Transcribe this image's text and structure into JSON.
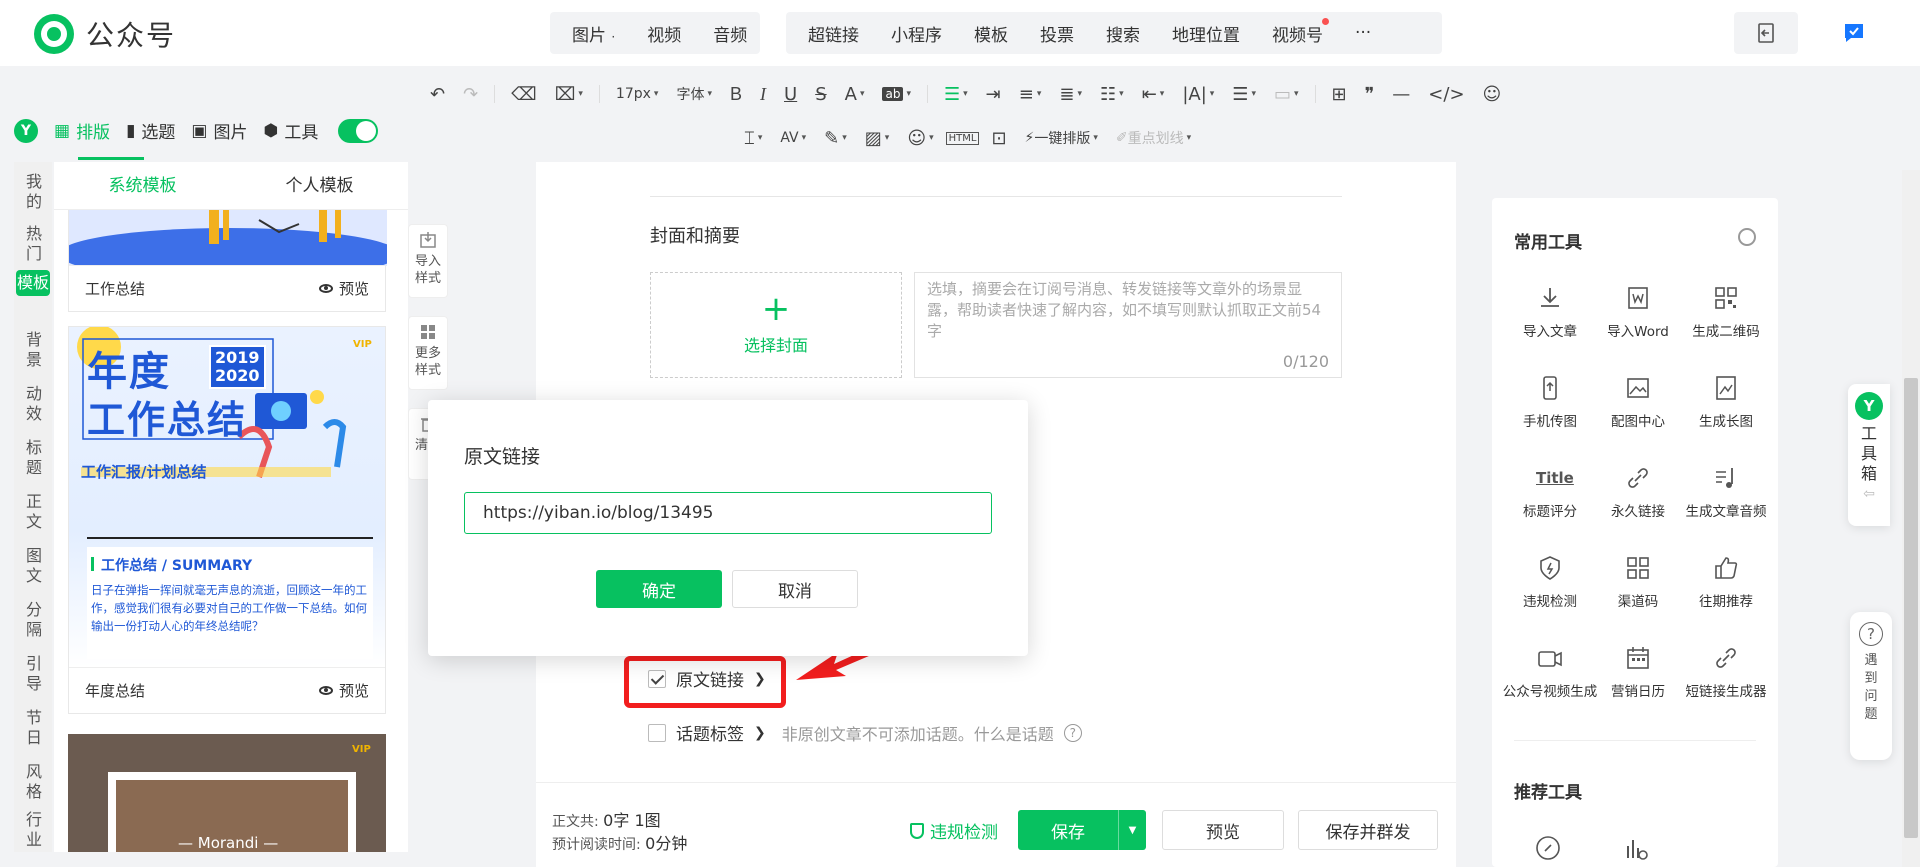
{
  "app": {
    "title": "公众号"
  },
  "top_menu": {
    "group1": [
      {
        "label": "图片",
        "caret": "·"
      },
      {
        "label": "视频"
      },
      {
        "label": "音频"
      }
    ],
    "group2": [
      {
        "label": "超链接"
      },
      {
        "label": "小程序"
      },
      {
        "label": "模板"
      },
      {
        "label": "投票"
      },
      {
        "label": "搜索"
      },
      {
        "label": "地理位置"
      },
      {
        "label": "视频号"
      },
      {
        "label": "···"
      }
    ]
  },
  "toolbar": {
    "font_size": "17px",
    "font_family": "字体",
    "bold": "B",
    "italic": "I",
    "underline": "U",
    "strike": "S",
    "font_color": "A",
    "bg_color": "ab",
    "quote": "❞",
    "one_click": "一键排版",
    "highlight": "重点划线"
  },
  "plugin_tabs": [
    {
      "label": "排版",
      "active": true
    },
    {
      "label": "选题"
    },
    {
      "label": "图片"
    },
    {
      "label": "工具"
    }
  ],
  "plugin_badge": "Y",
  "categories": [
    {
      "label": "我的"
    },
    {
      "label": "热门"
    },
    {
      "label": "模板",
      "active": true
    },
    {
      "label": "背景"
    },
    {
      "label": "动效"
    },
    {
      "label": "标题"
    },
    {
      "label": "正文"
    },
    {
      "label": "图文"
    },
    {
      "label": "分隔"
    },
    {
      "label": "引导"
    },
    {
      "label": "节日"
    },
    {
      "label": "风格"
    },
    {
      "label": "行业"
    }
  ],
  "template_panel": {
    "tabs": [
      {
        "label": "系统模板",
        "active": true
      },
      {
        "label": "个人模板"
      }
    ],
    "cards": [
      {
        "name": "工作总结",
        "preview": "预览"
      },
      {
        "name": "年度总结",
        "preview": "预览",
        "vip": "VIP",
        "year_top": "2019",
        "year_bottom": "2020",
        "headline1": "年度",
        "headline2": "工作总结",
        "subline": "工作汇报/计划总结",
        "section_title": "工作总结 / SUMMARY",
        "body": "日子在弹指一挥间就毫无声息的流逝，回顾这一年的工作，感觉我们很有必要对自己的工作做一下总结。如何输出一份打动人心的年终总结呢？"
      },
      {
        "vip": "VIP",
        "caption": "— Morandi —"
      }
    ]
  },
  "side_buttons": [
    {
      "label": "导入样式"
    },
    {
      "label": "更多样式"
    },
    {
      "label": "清文"
    }
  ],
  "editor": {
    "cover_section_title": "封面和摘要",
    "cover_button": "选择封面",
    "summary_placeholder": "选填，摘要会在订阅号消息、转发链接等文章外的场景显露，帮助读者快速了解内容，如不填写则默认抓取正文前54字",
    "summary_count": "0/120",
    "original_link_label": "原文链接",
    "original_link_checked": true,
    "topic_label": "话题标签",
    "topic_note": "非原创文章不可添加话题。什么是话题",
    "topic_help": "?"
  },
  "dialog": {
    "title": "原文链接",
    "input_value": "https://yiban.io/blog/13495",
    "confirm": "确定",
    "cancel": "取消"
  },
  "bottom": {
    "stats_line1_label": "正文共:",
    "stats_line1_value": "0字 1图",
    "stats_line2_label": "预计阅读时间:",
    "stats_line2_value": "0分钟",
    "violation_check": "违规检测",
    "save": "保存",
    "preview": "预览",
    "save_publish": "保存并群发"
  },
  "tools_panel": {
    "title": "常用工具",
    "tools": [
      {
        "label": "导入文章",
        "icon": "import-article-icon"
      },
      {
        "label": "导入Word",
        "icon": "word-icon"
      },
      {
        "label": "生成二维码",
        "icon": "qrcode-icon"
      },
      {
        "label": "手机传图",
        "icon": "phone-upload-icon"
      },
      {
        "label": "配图中心",
        "icon": "image-center-icon"
      },
      {
        "label": "生成长图",
        "icon": "long-image-icon"
      },
      {
        "label": "标题评分",
        "icon": "title-score-icon",
        "glyph": "Title"
      },
      {
        "label": "永久链接",
        "icon": "permalink-icon"
      },
      {
        "label": "生成文章音频",
        "icon": "audio-icon"
      },
      {
        "label": "违规检测",
        "icon": "violation-icon"
      },
      {
        "label": "渠道码",
        "icon": "channel-code-icon"
      },
      {
        "label": "往期推荐",
        "icon": "thumbs-up-icon"
      },
      {
        "label": "公众号视频生成",
        "icon": "video-gen-icon"
      },
      {
        "label": "营销日历",
        "icon": "calendar-icon"
      },
      {
        "label": "短链接生成器",
        "icon": "short-link-icon"
      }
    ],
    "recommended_title": "推荐工具"
  },
  "toolbox": {
    "badge": "Y",
    "label": "工具箱"
  },
  "help": {
    "label": "遇到问题",
    "glyph": "?"
  },
  "colors": {
    "accent": "#07c160",
    "highlight_red": "#f21e1e",
    "title_blue": "#1f58d6"
  }
}
